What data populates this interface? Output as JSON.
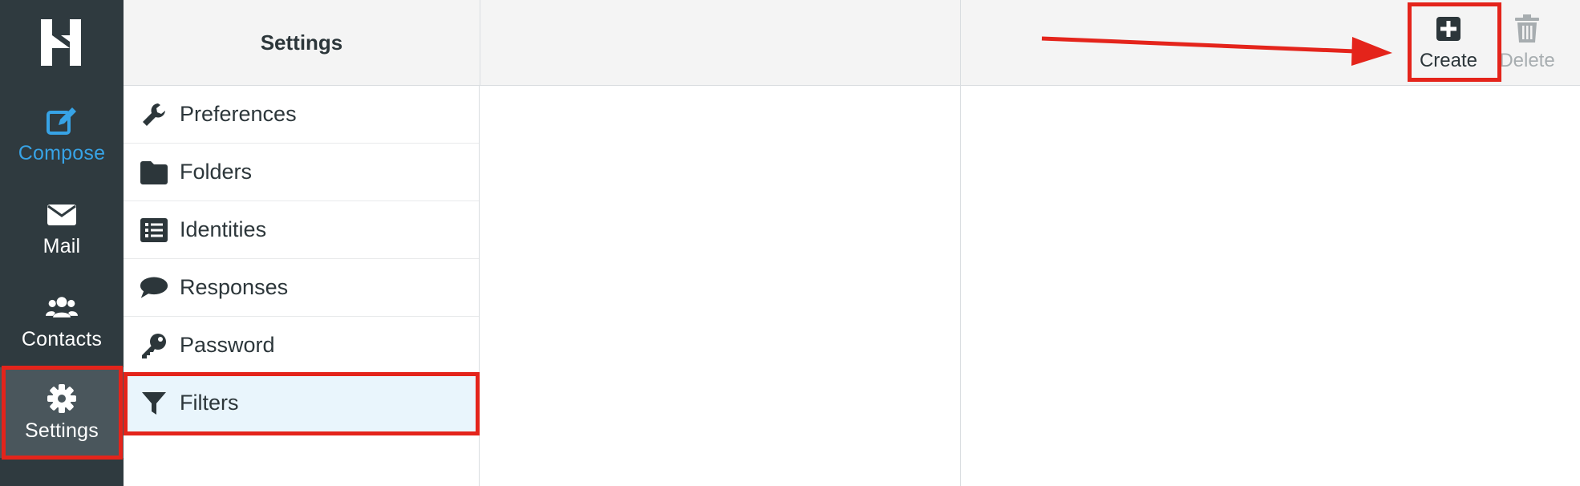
{
  "rail": {
    "logo_icon": "hestia-logo",
    "items": [
      {
        "label": "Compose",
        "icon": "pencil-square-icon",
        "color": "#37a3e6"
      },
      {
        "label": "Mail",
        "icon": "envelope-icon"
      },
      {
        "label": "Contacts",
        "icon": "users-icon"
      },
      {
        "label": "Settings",
        "icon": "gear-icon",
        "active": true
      }
    ]
  },
  "header": {
    "title": "Settings",
    "create_label": "Create",
    "delete_label": "Delete"
  },
  "settings_list": {
    "items": [
      {
        "label": "Preferences",
        "icon": "wrench-icon"
      },
      {
        "label": "Folders",
        "icon": "folder-icon"
      },
      {
        "label": "Identities",
        "icon": "list-icon"
      },
      {
        "label": "Responses",
        "icon": "comment-icon"
      },
      {
        "label": "Password",
        "icon": "key-icon"
      },
      {
        "label": "Filters",
        "icon": "filter-icon",
        "selected": true
      }
    ]
  },
  "colors": {
    "rail_bg": "#2f3a3f",
    "accent": "#37a3e6",
    "annotation_red": "#e4241b",
    "selected_bg": "#e9f5fc"
  }
}
